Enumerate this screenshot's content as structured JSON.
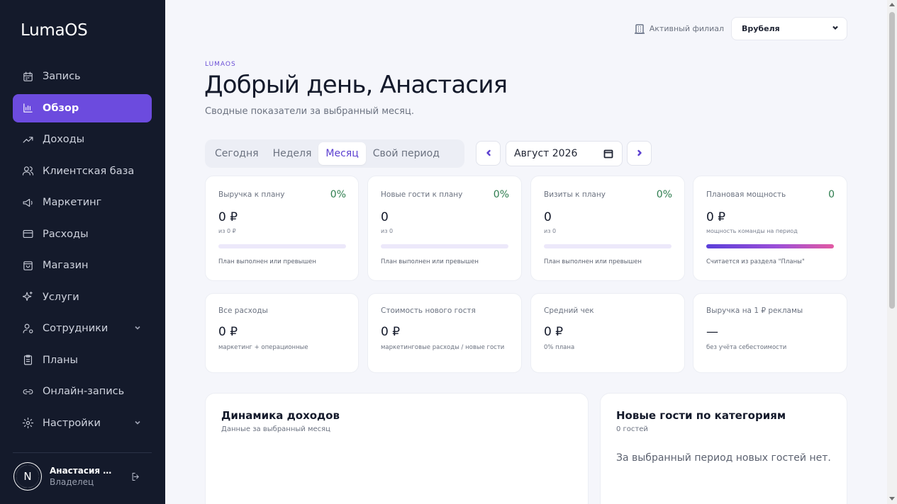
{
  "app": {
    "brand": "LumaOS"
  },
  "sidebar": {
    "items": [
      {
        "label": "Запись",
        "icon": "calendar-icon",
        "active": false
      },
      {
        "label": "Обзор",
        "icon": "bar-chart-icon",
        "active": true
      },
      {
        "label": "Доходы",
        "icon": "trend-up-icon",
        "active": false
      },
      {
        "label": "Клиентская база",
        "icon": "users-icon",
        "active": false
      },
      {
        "label": "Маркетинг",
        "icon": "megaphone-icon",
        "active": false
      },
      {
        "label": "Расходы",
        "icon": "credit-card-icon",
        "active": false
      },
      {
        "label": "Магазин",
        "icon": "shopping-bag-icon",
        "active": false
      },
      {
        "label": "Услуги",
        "icon": "sparkles-icon",
        "active": false
      },
      {
        "label": "Сотрудники",
        "icon": "user-cog-icon",
        "active": false,
        "expandable": true
      },
      {
        "label": "Планы",
        "icon": "clipboard-icon",
        "active": false
      },
      {
        "label": "Онлайн-запись",
        "icon": "link-icon",
        "active": false
      },
      {
        "label": "Настройки",
        "icon": "settings-gear-icon",
        "active": false,
        "expandable": true
      }
    ],
    "user": {
      "initial": "N",
      "name": "Анастасия Же...",
      "role": "Владелец"
    }
  },
  "header": {
    "branch_label": "Активный филиал",
    "branch_value": "Врубеля",
    "eyebrow": "LUMAOS",
    "title": "Добрый день, Анастасия",
    "subtitle": "Сводные показатели за выбранный месяц."
  },
  "period": {
    "tabs": [
      "Сегодня",
      "Неделя",
      "Месяц",
      "Свой период"
    ],
    "active_tab": "Месяц",
    "date_value": "Август 2026"
  },
  "kpi_row1": [
    {
      "title": "Выручка к плану",
      "pct": "0%",
      "value": "0 ₽",
      "sub": "из 0 ₽",
      "progress": 0,
      "foot": "План выполнен или превышен"
    },
    {
      "title": "Новые гости к плану",
      "pct": "0%",
      "value": "0",
      "sub": "из 0",
      "progress": 0,
      "foot": "План выполнен или превышен"
    },
    {
      "title": "Визиты к плану",
      "pct": "0%",
      "value": "0",
      "sub": "из 0",
      "progress": 0,
      "foot": "План выполнен или превышен"
    },
    {
      "title": "Плановая мощность",
      "pct": "0",
      "value": "0 ₽",
      "sub": "мощность команды на период",
      "progress": 1,
      "foot": "Считается из раздела \"Планы\""
    }
  ],
  "kpi_row2": [
    {
      "title": "Все расходы",
      "value": "0 ₽",
      "sub": "маркетинг + операционные"
    },
    {
      "title": "Стоимость нового гостя",
      "value": "0 ₽",
      "sub": "маркетинговые расходы / новые гости"
    },
    {
      "title": "Средний чек",
      "value": "0 ₽",
      "sub": "0% плана"
    },
    {
      "title": "Выручка на 1 ₽ рекламы",
      "value": "—",
      "sub": "без учёта себестоимости"
    }
  ],
  "panels": {
    "income": {
      "title": "Динамика доходов",
      "subtitle": "Данные за выбранный месяц"
    },
    "new_guests": {
      "title": "Новые гости по категориям",
      "subtitle": "0 гостей",
      "empty": "За выбранный период новых гостей нет."
    }
  },
  "colors": {
    "accent": "#6c4bde",
    "sidebar_bg": "#141a2b",
    "positive": "#2e7d4f"
  }
}
